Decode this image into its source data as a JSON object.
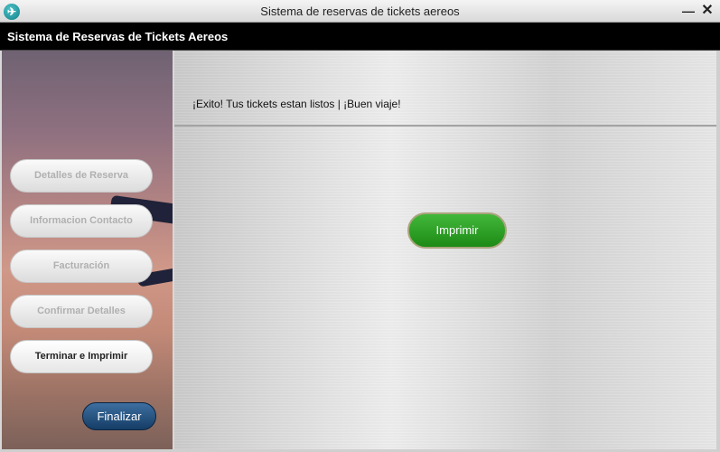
{
  "window": {
    "title": "Sistema de reservas de tickets aereos",
    "minimize_label": "—",
    "close_label": "✕"
  },
  "header": {
    "title": "Sistema de Reservas de Tickets Aereos"
  },
  "sidebar": {
    "items": [
      {
        "label": "Detalles de Reserva",
        "active": false
      },
      {
        "label": "Informacion Contacto",
        "active": false
      },
      {
        "label": "Facturación",
        "active": false
      },
      {
        "label": "Confirmar Detalles",
        "active": false
      },
      {
        "label": "Terminar e Imprimir",
        "active": true
      }
    ],
    "finish_label": "Finalizar"
  },
  "main": {
    "message": "¡Exito! Tus tickets estan listos | ¡Buen viaje!",
    "print_label": "Imprimir"
  },
  "icons": {
    "app": "airplane-icon"
  },
  "colors": {
    "header_bg": "#000000",
    "print_button": "#2ea626",
    "finish_button": "#1f4a77"
  }
}
